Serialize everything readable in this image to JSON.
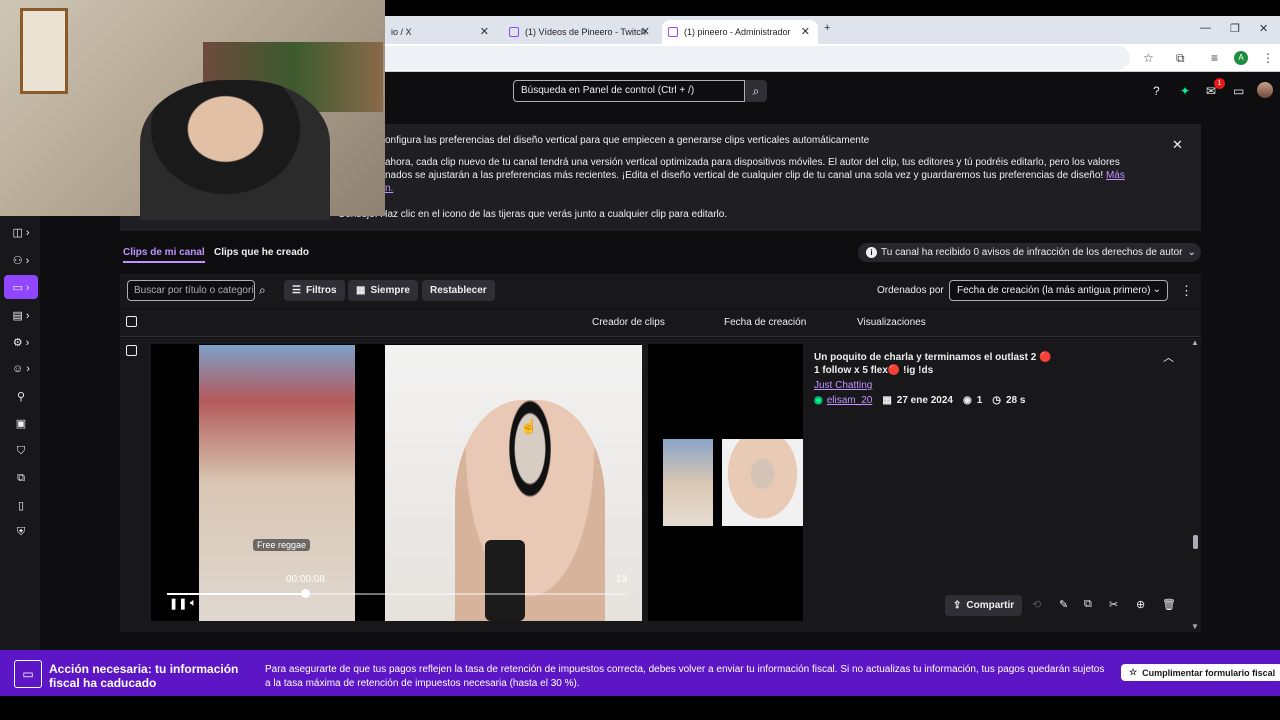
{
  "browser": {
    "tabs": [
      {
        "label": "io / X"
      },
      {
        "label": "(1) Vídeos de Pineero - Twitch"
      },
      {
        "label": "(1) pineero - Administrador"
      }
    ],
    "new_tab": "+",
    "profile_initial": "A"
  },
  "nav": {
    "search_placeholder": "Búsqueda en Panel de control (Ctrl + /)",
    "notification_count": "1"
  },
  "banner": {
    "line1": "onfigura las preferencias del diseño vertical para que empiecen a generarse clips verticales automáticamente",
    "line2": "ahora, cada clip nuevo de tu canal tendrá una versión vertical optimizada para dispositivos móviles. El autor del clip, tus editores y tú podréis editarlo, pero los valores",
    "line3": "nados se ajustarán a las preferencias más recientes. ¡Edita el diseño vertical de cualquier clip de tu canal una sola vez y guardaremos tus preferencias de diseño!",
    "link_part1": "Más",
    "link_part2": "n.",
    "tip": "Consejo: Haz clic en el icono de las tijeras que verás junto a cualquier clip para editarlo."
  },
  "tabs": {
    "mine": "Clips de mi canal",
    "created": "Clips que he creado"
  },
  "copyright": "Tu canal ha recibido 0 avisos de infracción de los derechos de autor",
  "filters": {
    "search_placeholder": "Buscar por título o categoría",
    "filters": "Filtros",
    "always": "Siempre",
    "reset": "Restablecer",
    "sort_label": "Ordenados por",
    "sort_value": "Fecha de creación (la más antigua primero)"
  },
  "columns": {
    "creator": "Creador de clips",
    "date": "Fecha de creación",
    "views": "Visualizaciones"
  },
  "clip": {
    "title": "Un poquito de charla y terminamos el outlast 2 🔴 1 follow x 5 flex🔴 !ig !ds",
    "category": "Just Chatting",
    "creator": "elisam_20",
    "date": "27 ene 2024",
    "views": "1",
    "duration": "28 s",
    "share": "Compartir",
    "player_time": "00:00:08",
    "frame": "19",
    "overlay_tag": "Free reggae",
    "progress": 0.3
  },
  "alert": {
    "title": "Acción necesaria: tu información fiscal ha caducado",
    "body": "Para asegurarte de que tus pagos reflejen la tasa de retención de impuestos correcta, debes volver a enviar tu información fiscal. Si no actualizas tu información, tus pagos quedarán sujetos a la tasa máxima de retención de impuestos necesaria (hasta el 30 %).",
    "button": "Cumplimentar formulario fiscal"
  },
  "colors": {
    "accent": "#9146ff",
    "link": "#bf94ff",
    "alert_bg": "#5c16c5"
  }
}
